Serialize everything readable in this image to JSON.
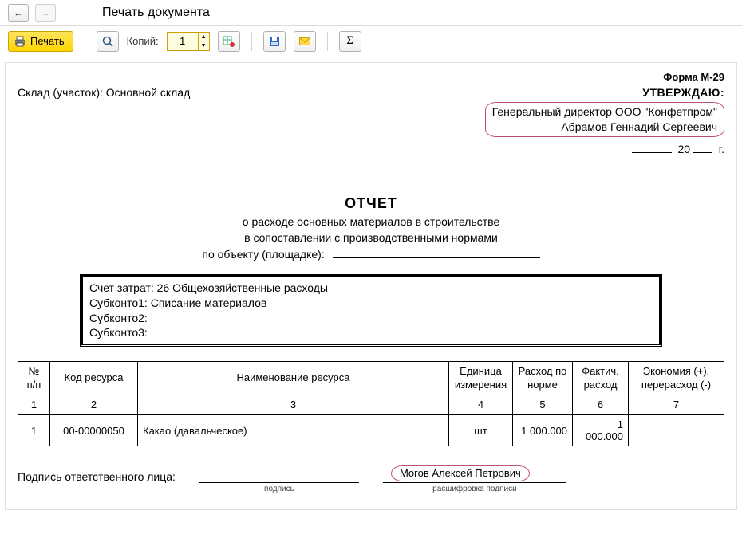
{
  "window": {
    "title": "Печать документа"
  },
  "toolbar": {
    "print_label": "Печать",
    "copies_label": "Копий:",
    "copies_value": "1"
  },
  "doc": {
    "form_no": "Форма М-29",
    "warehouse_label": "Склад (участок): ",
    "warehouse_value": "Основной склад",
    "approve": {
      "caption": "УТВЕРЖДАЮ:",
      "line1": "Генеральный директор ООО \"Конфетпром\"",
      "line2": "Абрамов Геннадий Сергеевич",
      "year_prefix": "20",
      "year_suffix": "г."
    },
    "report": {
      "title": "ОТЧЕТ",
      "sub1": "о расходе основных материалов в строительстве",
      "sub2": "в сопоставлении с производственными нормами",
      "object_label": "по объекту (площадке):"
    },
    "cost": {
      "l1_label": "Счет затрат: ",
      "l1_value": "26 Общехозяйственные расходы",
      "l2_label": "Субконто1: ",
      "l2_value": "Списание материалов",
      "l3_label": "Субконто2:",
      "l4_label": "Субконто3:"
    },
    "table": {
      "headers": {
        "num": "№ п/п",
        "code": "Код ресурса",
        "name": "Наименование ресурса",
        "unit": "Единица измерения",
        "norm": "Расход по норме",
        "fact": "Фактич. расход",
        "delta": "Экономия (+), перерасход (-)"
      },
      "colnums": [
        "1",
        "2",
        "3",
        "4",
        "5",
        "6",
        "7"
      ],
      "rows": [
        {
          "num": "1",
          "code": "00-00000050",
          "name": "Какао (давальческое)",
          "unit": "шт",
          "norm": "1 000.000",
          "fact": "1 000.000",
          "delta": ""
        }
      ]
    },
    "sign": {
      "label": "Подпись ответственного лица:",
      "cap1": "подпись",
      "name": "Могов Алексей Петрович",
      "cap2": "расшифровка подписи"
    }
  }
}
